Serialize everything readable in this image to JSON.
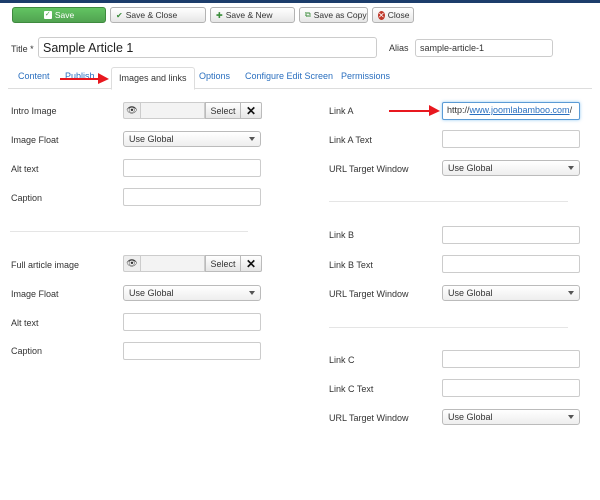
{
  "toolbar": {
    "save_label": "Save",
    "save_close_label": "Save & Close",
    "save_new_label": "Save & New",
    "save_copy_label": "Save as Copy",
    "close_label": "Close"
  },
  "form": {
    "title_label": "Title *",
    "title_value": "Sample Article 1",
    "alias_label": "Alias",
    "alias_value": "sample-article-1"
  },
  "tabs": [
    "Content",
    "Publish",
    "Images and links",
    "Options",
    "Configure Edit Screen",
    "Permissions"
  ],
  "active_tab": "Images and links",
  "intro": {
    "image_label": "Intro Image",
    "select_label": "Select",
    "float_label": "Image Float",
    "float_value": "Use Global",
    "alt_label": "Alt text",
    "caption_label": "Caption"
  },
  "full": {
    "image_label": "Full article image",
    "select_label": "Select",
    "float_label": "Image Float",
    "float_value": "Use Global",
    "alt_label": "Alt text",
    "caption_label": "Caption"
  },
  "link_a": {
    "label": "Link A",
    "value_prefix": "http://",
    "value_host": "www.joomlabamboo.com",
    "value_suffix": "/",
    "text_label": "Link A Text",
    "target_label": "URL Target Window",
    "target_value": "Use Global"
  },
  "link_b": {
    "label": "Link B",
    "text_label": "Link B Text",
    "target_label": "URL Target Window",
    "target_value": "Use Global"
  },
  "link_c": {
    "label": "Link C",
    "text_label": "Link C Text",
    "target_label": "URL Target Window",
    "target_value": "Use Global"
  },
  "colors": {
    "save_green": "#51a351",
    "link_blue": "#2a6fbf",
    "arrow_red": "#e8181f",
    "close_red": "#c0392b"
  },
  "icons": [
    "check-icon",
    "check-icon",
    "plus-icon",
    "copy-icon",
    "close-icon",
    "eye-icon",
    "clear-icon",
    "caret-down-icon",
    "arrow-icon"
  ]
}
